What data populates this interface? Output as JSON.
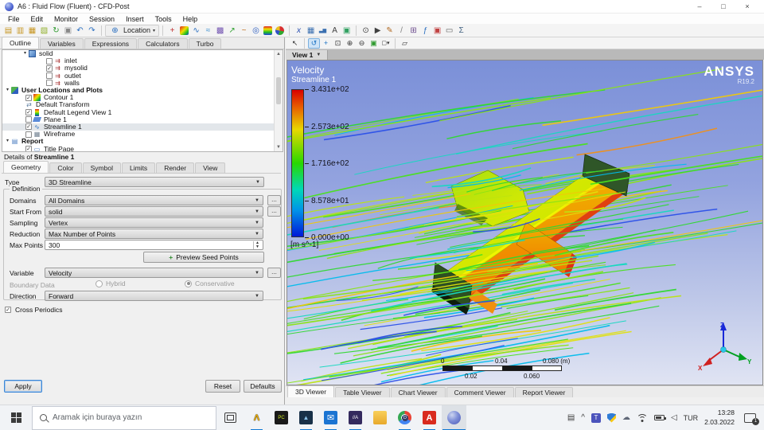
{
  "window": {
    "title": "A6 : Fluid Flow (Fluent) - CFD-Post",
    "minimize_glyph": "–",
    "maximize_glyph": "□",
    "close_glyph": "×"
  },
  "menu": [
    "File",
    "Edit",
    "Monitor",
    "Session",
    "Insert",
    "Tools",
    "Help"
  ],
  "toolbar": {
    "groups": [
      {
        "name": "file-toolbar",
        "icons": [
          {
            "n": "open-case-icon",
            "g": "▤",
            "c": "#c79520"
          },
          {
            "n": "load-state-icon",
            "g": "▥",
            "c": "#c79520"
          },
          {
            "n": "save-state-icon",
            "g": "▦",
            "c": "#c79520"
          },
          {
            "n": "save-project-icon",
            "g": "▧",
            "c": "#8fae28"
          },
          {
            "n": "refresh-icon",
            "g": "↻",
            "c": "#2d9a2d"
          },
          {
            "n": "snapshot-icon",
            "g": "▣",
            "c": "#888888"
          },
          {
            "n": "undo-icon",
            "g": "↶",
            "c": "#2b6fc0"
          },
          {
            "n": "redo-icon",
            "g": "↷",
            "c": "#2b6fc0"
          }
        ]
      },
      {
        "name": "location-toolbar",
        "location": true,
        "icon": {
          "n": "globe-icon",
          "g": "⊕",
          "c": "#2b6fc0"
        },
        "label": "Location",
        "caret": "▾"
      },
      {
        "name": "insert-toolbar",
        "icons": [
          {
            "n": "point-icon",
            "g": "+",
            "c": "#c03030"
          },
          {
            "n": "contour-icon",
            "bg": "linear-gradient(135deg,#e02020,#f0e000 45%,#20c020 75%,#2040e0)"
          },
          {
            "n": "streamline-icon",
            "g": "∿",
            "c": "#2b6fc0"
          },
          {
            "n": "surface-streamline-icon",
            "g": "≈",
            "c": "#3b8fd0"
          },
          {
            "n": "volume-rendering-icon",
            "g": "▩",
            "c": "#7050b0"
          },
          {
            "n": "vector-icon",
            "g": "↗",
            "c": "#30a030"
          },
          {
            "n": "particle-track-icon",
            "g": "~",
            "c": "#c07020"
          },
          {
            "n": "turbo-plot-icon",
            "g": "◎",
            "c": "#3060c0"
          },
          {
            "n": "legend-icon",
            "bg": "linear-gradient(180deg,#e02020,#f0e000,#20c020,#2040e0)"
          },
          {
            "n": "pie-chart-icon",
            "bg": "conic-gradient(#d83030 0 28%,#30a830 28% 55%,#3050c8 55% 78%,#e8c020 78%)",
            "round": true
          }
        ]
      },
      {
        "name": "report-toolbar",
        "icons": [
          {
            "n": "expression-icon",
            "g": "x",
            "c": "#2b50b0",
            "italic": true
          },
          {
            "n": "table-icon",
            "g": "▦",
            "c": "#3a6fb0"
          },
          {
            "n": "chart-icon",
            "g": "▃▆",
            "c": "#3a6fb0",
            "fs": 6
          },
          {
            "n": "comment-icon",
            "g": "A",
            "c": "#404040"
          },
          {
            "n": "figure-icon",
            "g": "▣",
            "c": "#30a060"
          }
        ]
      },
      {
        "name": "tools-toolbar",
        "icons": [
          {
            "n": "timestep-icon",
            "g": "⊙",
            "c": "#404040"
          },
          {
            "n": "animation-icon",
            "g": "▶",
            "c": "#404040"
          },
          {
            "n": "quick-editor-icon",
            "g": "✎",
            "c": "#b06820"
          },
          {
            "n": "probe-icon",
            "g": "/",
            "c": "#808080"
          },
          {
            "n": "calculators-icon",
            "g": "⊞",
            "c": "#705090"
          },
          {
            "n": "function-calculator-icon",
            "g": "ƒ",
            "c": "#2b6fc0"
          },
          {
            "n": "save-picture-icon",
            "g": "▣",
            "c": "#c04040"
          },
          {
            "n": "print-icon",
            "g": "▭",
            "c": "#606060"
          },
          {
            "n": "macro-calculator-icon",
            "g": "Σ",
            "c": "#406080"
          }
        ]
      }
    ]
  },
  "left_tabs": {
    "items": [
      "Outline",
      "Variables",
      "Expressions",
      "Calculators",
      "Turbo"
    ],
    "active": "Outline"
  },
  "tree": {
    "items": [
      {
        "label": "solid",
        "pad": 24,
        "exp": true,
        "cb": null,
        "icon": "ti-domain",
        "glyph": "",
        "iconname": "domain-icon"
      },
      {
        "label": "inlet",
        "pad": 46,
        "cb": false,
        "glyph": "⇉",
        "color": "#a83030",
        "iconname": "boundary-icon"
      },
      {
        "label": "mysolid",
        "pad": 46,
        "cb": true,
        "glyph": "⇉",
        "color": "#a83030",
        "iconname": "boundary-icon"
      },
      {
        "label": "outlet",
        "pad": 46,
        "cb": false,
        "glyph": "⇉",
        "color": "#a83030",
        "iconname": "boundary-icon"
      },
      {
        "label": "walls",
        "pad": 46,
        "cb": false,
        "glyph": "⇉",
        "color": "#a83030",
        "iconname": "boundary-icon"
      },
      {
        "label": "User Locations and Plots",
        "pad": 2,
        "exp": true,
        "cb": null,
        "icon": "ti-plots",
        "bold": true,
        "iconname": "plots-folder-icon"
      },
      {
        "label": "Contour 1",
        "pad": 20,
        "cb": true,
        "icon": "ti-contour",
        "iconname": "contour-icon"
      },
      {
        "label": "Default Transform",
        "pad": 20,
        "cb": null,
        "glyph": "⇄",
        "color": "#5a7ca0",
        "iconname": "transform-icon"
      },
      {
        "label": "Default Legend View 1",
        "pad": 20,
        "cb": true,
        "icon": "ti-legend",
        "iconname": "legend-icon"
      },
      {
        "label": "Plane 1",
        "pad": 20,
        "cb": false,
        "icon": "ti-plane",
        "iconname": "plane-icon"
      },
      {
        "label": "Streamline 1",
        "pad": 20,
        "cb": true,
        "glyph": "∿",
        "color": "#2b6fc0",
        "sel": true,
        "iconname": "streamline-icon"
      },
      {
        "label": "Wireframe",
        "pad": 20,
        "cb": false,
        "glyph": "▦",
        "color": "#708090",
        "iconname": "wireframe-icon"
      },
      {
        "label": "Report",
        "pad": 2,
        "exp": true,
        "cb": null,
        "glyph": "▤",
        "color": "#4a7cc0",
        "bold": true,
        "iconname": "report-folder-icon"
      },
      {
        "label": "Title Page",
        "pad": 20,
        "cb": true,
        "glyph": "▭",
        "color": "#4a7cc0",
        "iconname": "title-page-icon"
      },
      {
        "label": "",
        "pad": 20,
        "cb": true,
        "glyph": "▭",
        "color": "#4a7cc0",
        "iconname": "clipped-icon"
      }
    ]
  },
  "details": {
    "title_prefix": "Details of ",
    "title_name": "Streamline 1",
    "tabs": [
      "Geometry",
      "Color",
      "Symbol",
      "Limits",
      "Render",
      "View"
    ],
    "active_tab": "Geometry",
    "type": {
      "label": "Type",
      "value": "3D Streamline"
    },
    "group_label": "Definition",
    "domains": {
      "label": "Domains",
      "value": "All Domains",
      "more": "..."
    },
    "start_from": {
      "label": "Start From",
      "value": "solid",
      "more": "..."
    },
    "sampling": {
      "label": "Sampling",
      "value": "Vertex"
    },
    "reduction": {
      "label": "Reduction",
      "value": "Max Number of Points"
    },
    "max_points": {
      "label": "Max Points",
      "value": "300"
    },
    "preview_button": "Preview Seed Points",
    "variable": {
      "label": "Variable",
      "value": "Velocity",
      "more": "..."
    },
    "boundary_data": {
      "label": "Boundary Data",
      "options": [
        "Hybrid",
        "Conservative"
      ],
      "selected": "Conservative"
    },
    "direction": {
      "label": "Direction",
      "value": "Forward"
    },
    "cross_periodics": {
      "label": "Cross Periodics",
      "checked": true
    },
    "apply": "Apply",
    "reset": "Reset",
    "defaults": "Defaults"
  },
  "viewer": {
    "toolbar": [
      {
        "n": "probe-select-icon",
        "g": "↖",
        "c": "#303030"
      },
      {
        "sep": true
      },
      {
        "n": "rotate-icon",
        "g": "↺",
        "c": "#1b72c4",
        "active": true
      },
      {
        "n": "pan-icon",
        "g": "+",
        "c": "#1b72c4"
      },
      {
        "n": "zoom-box-icon",
        "g": "⊡",
        "c": "#303030"
      },
      {
        "n": "zoom-in-icon",
        "g": "⊕",
        "c": "#303030"
      },
      {
        "n": "zoom-out-icon",
        "g": "⊖",
        "c": "#303030"
      },
      {
        "n": "fit-view-icon",
        "g": "▣",
        "c": "#2d9a2d"
      },
      {
        "n": "viewport-layout-icon",
        "g": "▢▾",
        "c": "#303030",
        "fs": 7
      },
      {
        "sep": true
      },
      {
        "n": "viewport-transform-icon",
        "g": "▱",
        "c": "#303030"
      }
    ],
    "view_tab": "View 1",
    "legend": {
      "title": "Velocity",
      "subtitle": "Streamline 1",
      "ticks": [
        "3.431e+02",
        "2.573e+02",
        "1.716e+02",
        "8.578e+01",
        "0.000e+00"
      ],
      "units": "[m s^-1]"
    },
    "logo": {
      "brand": "ANSYS",
      "version": "R19.2"
    },
    "ruler": {
      "top_labels": [
        "0",
        "0.04",
        "0.080 (m)"
      ],
      "bottom_labels": [
        "0.02",
        "0.060"
      ]
    },
    "triad": {
      "x": "X",
      "y": "Y",
      "z": "Z"
    },
    "bottom_tabs": {
      "items": [
        "3D Viewer",
        "Table Viewer",
        "Chart Viewer",
        "Comment Viewer",
        "Report Viewer"
      ],
      "active": "3D Viewer"
    }
  },
  "scene": {
    "seed": 13,
    "slope": -0.17,
    "jitter": 0.05,
    "back": 62,
    "front": 42,
    "cluster_back": 14,
    "cluster_front": 26,
    "accents": 5,
    "accent_color": "#2b50e8",
    "palette": [
      {
        "c": "#2fd82f",
        "w": 20
      },
      {
        "c": "#4ae01e",
        "w": 16
      },
      {
        "c": "#8ae414",
        "w": 13
      },
      {
        "c": "#bce410",
        "w": 9
      },
      {
        "c": "#e0e00c",
        "w": 7
      },
      {
        "c": "#f0c808",
        "w": 4
      },
      {
        "c": "#16d8c0",
        "w": 12
      },
      {
        "c": "#00bcec",
        "w": 9
      },
      {
        "c": "#2b50e8",
        "w": 4
      },
      {
        "c": "#f09018",
        "w": 3
      }
    ]
  },
  "taskbar": {
    "search_placeholder": "Aramak için buraya yazın",
    "apps": [
      {
        "n": "app-ansys",
        "g": "Λ",
        "c": "#f0b000",
        "bold": true,
        "shadow": true,
        "running": true
      },
      {
        "n": "app-pycharm",
        "g": "PC",
        "c": "#d0e820",
        "bg": "#1a1a1a",
        "fs": 6,
        "running": false
      },
      {
        "n": "app-photos",
        "g": "▲",
        "c": "#8ac0e8",
        "bg": "#183048",
        "fs": 8,
        "running": true
      },
      {
        "n": "app-mail",
        "g": "✉",
        "c": "#ffffff",
        "bg": "#1b74d2",
        "running": true
      },
      {
        "n": "app-movavi",
        "g": "//A",
        "c": "#ffffff",
        "bg": "#342a5e",
        "fs": 6,
        "running": true
      },
      {
        "n": "app-explorer",
        "bg": "linear-gradient(180deg,#f8cf5a,#e8a92c)",
        "running": false
      },
      {
        "n": "app-chrome",
        "bg": "radial-gradient(circle at 50% 50%,#4285f4 0 28%,#ffffff 28% 36%,transparent 36%),conic-gradient(#ea4335 0 33%,#4285f4 33% 66%,#34a853 66%)",
        "round": true,
        "badge": "D",
        "running": true
      },
      {
        "n": "app-acrobat",
        "g": "A",
        "c": "#ffffff",
        "bg": "#d92b1f",
        "bold": true,
        "running": true
      },
      {
        "n": "app-cfdpost",
        "bg": "radial-gradient(circle at 35% 30%,#cdd6f0,#8090d8 45%,#4a58b8)",
        "round": true,
        "active": true,
        "running": true
      }
    ],
    "tray": {
      "icons": [
        {
          "n": "news-widget-icon",
          "g": "▤",
          "c": "#3c3c3c"
        },
        {
          "n": "tray-expand-icon",
          "g": "^",
          "c": "#3c3c3c"
        },
        {
          "n": "teams-icon",
          "kind": "teams",
          "g": "T"
        },
        {
          "n": "defender-shield-icon",
          "kind": "shield"
        },
        {
          "n": "onedrive-icon",
          "g": "☁",
          "c": "#606878"
        },
        {
          "n": "wifi-icon",
          "kind": "wifi"
        },
        {
          "n": "battery-icon",
          "kind": "battery"
        },
        {
          "n": "volume-icon",
          "g": "◁",
          "c": "#3c3c3c"
        }
      ],
      "language": "TUR",
      "time": "13:28",
      "date": "2.03.2022",
      "notification_badge": "1"
    }
  }
}
